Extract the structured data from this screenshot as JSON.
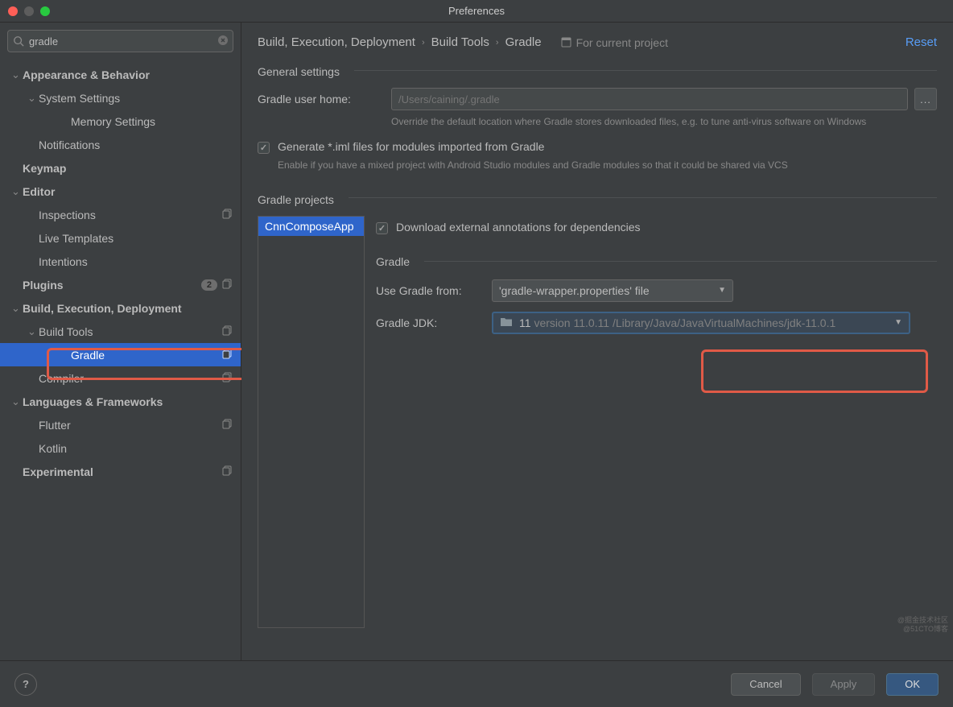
{
  "window": {
    "title": "Preferences"
  },
  "search": {
    "value": "gradle"
  },
  "sidebar": {
    "items": [
      {
        "label": "Appearance & Behavior",
        "bold": true,
        "chev": true,
        "level": 0
      },
      {
        "label": "System Settings",
        "chev": true,
        "level": 1
      },
      {
        "label": "Memory Settings",
        "level": 3
      },
      {
        "label": "Notifications",
        "level": 1
      },
      {
        "label": "Keymap",
        "bold": true,
        "level": 0
      },
      {
        "label": "Editor",
        "bold": true,
        "chev": true,
        "level": 0
      },
      {
        "label": "Inspections",
        "level": 1,
        "copy": true
      },
      {
        "label": "Live Templates",
        "level": 1
      },
      {
        "label": "Intentions",
        "level": 1
      },
      {
        "label": "Plugins",
        "bold": true,
        "level": 0,
        "badge": "2",
        "copy": true
      },
      {
        "label": "Build, Execution, Deployment",
        "bold": true,
        "chev": true,
        "level": 0
      },
      {
        "label": "Build Tools",
        "chev": true,
        "level": 1,
        "copy": true
      },
      {
        "label": "Gradle",
        "level": 3,
        "copy": true,
        "selected": true
      },
      {
        "label": "Compiler",
        "level": 1,
        "copy": true
      },
      {
        "label": "Languages & Frameworks",
        "bold": true,
        "chev": true,
        "level": 0
      },
      {
        "label": "Flutter",
        "level": 1,
        "copy": true
      },
      {
        "label": "Kotlin",
        "level": 1
      },
      {
        "label": "Experimental",
        "bold": true,
        "level": 0,
        "copy": true
      }
    ]
  },
  "breadcrumb": {
    "parts": [
      "Build, Execution, Deployment",
      "Build Tools",
      "Gradle"
    ],
    "scope": "For current project",
    "reset": "Reset"
  },
  "general": {
    "title": "General settings",
    "user_home_label": "Gradle user home:",
    "user_home_placeholder": "/Users/caining/.gradle",
    "user_home_hint": "Override the default location where Gradle stores downloaded files, e.g. to tune anti-virus software on Windows",
    "browse": "...",
    "iml_label": "Generate *.iml files for modules imported from Gradle",
    "iml_hint": "Enable if you have a mixed project with Android Studio modules and Gradle modules so that it could be shared via VCS"
  },
  "projects": {
    "title": "Gradle projects",
    "list": [
      "CnnComposeApp"
    ],
    "download_annotations": "Download external annotations for dependencies",
    "gradle_section": "Gradle",
    "use_from_label": "Use Gradle from:",
    "use_from_value": "'gradle-wrapper.properties' file",
    "jdk_label": "Gradle JDK:",
    "jdk_value": "11",
    "jdk_detail": "version 11.0.11 /Library/Java/JavaVirtualMachines/jdk-11.0.1"
  },
  "footer": {
    "cancel": "Cancel",
    "apply": "Apply",
    "ok": "OK"
  },
  "watermark": {
    "line1": "@掘金技术社区",
    "line2": "@51CTO博客"
  }
}
